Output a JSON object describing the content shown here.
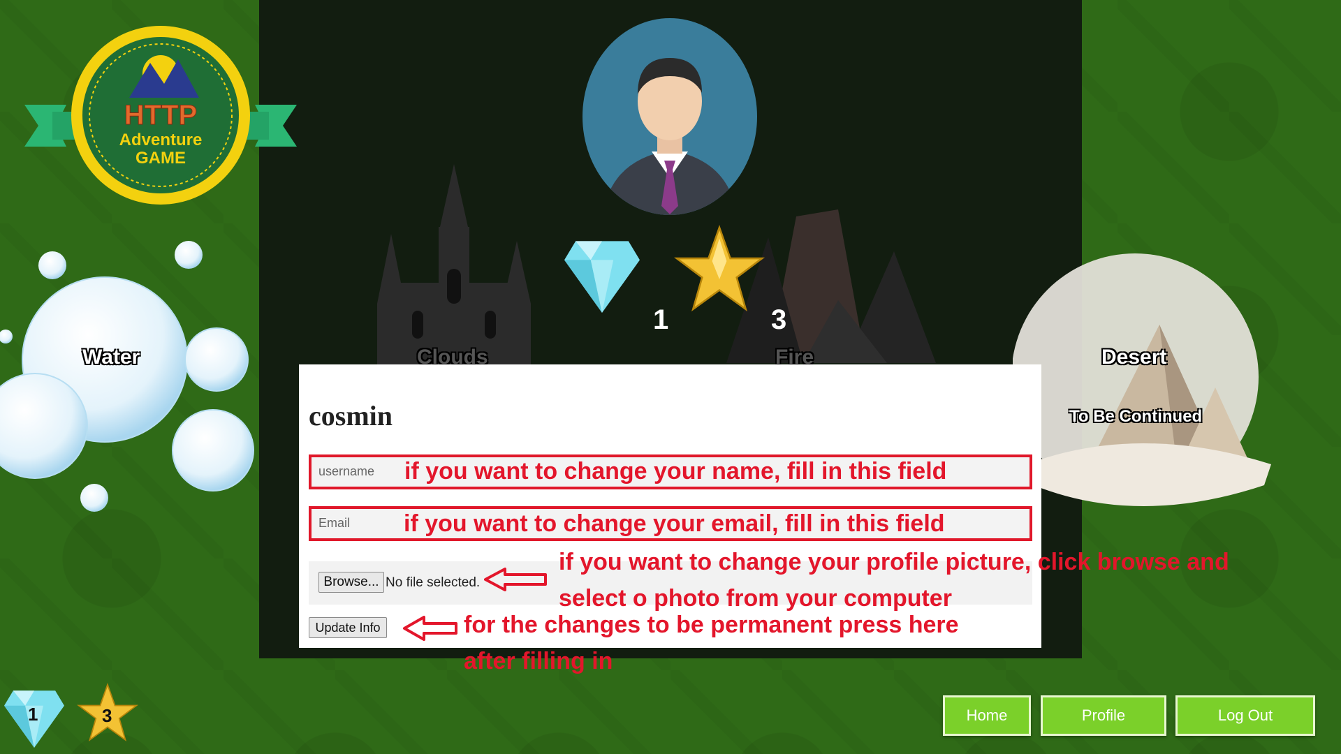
{
  "logo": {
    "line1": "HTTP",
    "line2": "Adventure",
    "line3": "GAME"
  },
  "regions": {
    "water": "Water",
    "clouds": "Clouds",
    "fire": "Fire",
    "desert": "Desert",
    "desert_status": "To Be Continued"
  },
  "stats": {
    "diamonds": "1",
    "stars": "3"
  },
  "profile": {
    "username": "cosmin",
    "username_placeholder": "username",
    "email_placeholder": "Email",
    "browse_label": "Browse...",
    "no_file_text": "No file selected.",
    "update_label": "Update Info"
  },
  "annotations": {
    "name_hint": "if you want to change your name, fill in this field",
    "email_hint": "if you want to change your email, fill in this field",
    "picture_hint_1": "if you want to change your profile picture, click browse and",
    "picture_hint_2": "select o photo from your computer",
    "update_hint_1": "for the changes to be permanent press here",
    "update_hint_2": "after filling in"
  },
  "nav": {
    "home": "Home",
    "profile": "Profile",
    "logout": "Log Out"
  },
  "colors": {
    "accent_red": "#e3162b",
    "nav_green": "#7bd02a",
    "panel_dark": "#121d10"
  },
  "icons": [
    "diamond-icon",
    "star-icon",
    "arrow-left-icon",
    "avatar-icon"
  ]
}
